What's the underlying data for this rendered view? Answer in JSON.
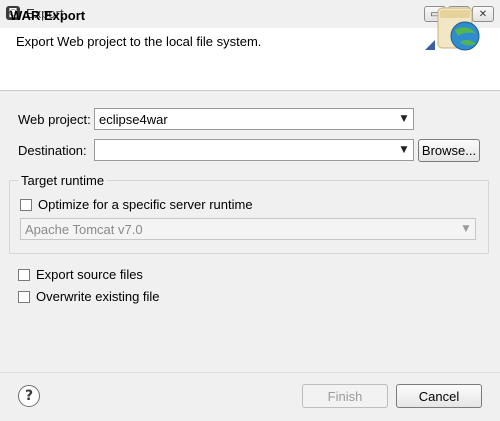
{
  "window": {
    "title": "Export",
    "app_icon_glyph": "◙",
    "buttons": {
      "minimize": "▭",
      "maximize": "□",
      "close": "✕"
    }
  },
  "header": {
    "title": "WAR Export",
    "description": "Export Web project to the local file system.",
    "icon": "jar-globe-icon"
  },
  "form": {
    "web_project": {
      "label": "Web project:",
      "value": "eclipse4war"
    },
    "destination": {
      "label": "Destination:",
      "value": "",
      "browse_label": "Browse..."
    },
    "target_runtime": {
      "group_label": "Target runtime",
      "optimize_label": "Optimize for a specific server runtime",
      "optimize_checked": false,
      "runtime_value": "Apache Tomcat v7.0"
    },
    "export_source": {
      "label": "Export source files",
      "checked": false
    },
    "overwrite": {
      "label": "Overwrite existing file",
      "checked": false
    }
  },
  "footer": {
    "help_glyph": "?",
    "finish_label": "Finish",
    "cancel_label": "Cancel"
  },
  "colors": {
    "window_bg": "#f0f0f0",
    "header_bg": "#ffffff"
  }
}
